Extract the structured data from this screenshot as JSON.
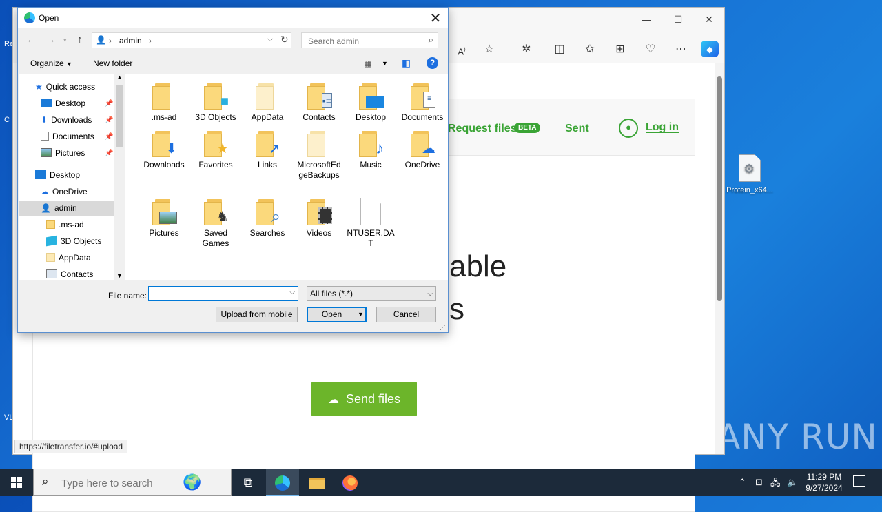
{
  "desktop": {
    "file_icon_label": "Protein_x64...",
    "left_fragments": [
      "Re",
      "C",
      "VL"
    ],
    "watermark": "ANY RUN"
  },
  "browser": {
    "window_controls": {
      "minimize": "—",
      "maximize": "☐",
      "close": "✕"
    },
    "toolbar_icons": [
      "read-aloud",
      "favorite-star",
      "extensions",
      "split-screen",
      "favorites",
      "collections",
      "browser-essentials",
      "more",
      "copilot"
    ],
    "page": {
      "nav": {
        "request_files": "Request files",
        "beta": "BETA",
        "sent": "Sent",
        "login": "Log in"
      },
      "hero_line1": "able",
      "hero_line2": "s",
      "send_button": "Send files"
    },
    "status_url": "https://filetransfer.io/#upload"
  },
  "dialog": {
    "title": "Open",
    "breadcrumb": [
      "admin"
    ],
    "search_placeholder": "Search admin",
    "organize_label": "Organize",
    "new_folder_label": "New folder",
    "nav_items": [
      {
        "label": "Quick access",
        "icon": "star-icon"
      },
      {
        "label": "Desktop",
        "icon": "desktop-icon",
        "pinned": true
      },
      {
        "label": "Downloads",
        "icon": "download-icon",
        "pinned": true
      },
      {
        "label": "Documents",
        "icon": "document-icon",
        "pinned": true
      },
      {
        "label": "Pictures",
        "icon": "picture-icon",
        "pinned": true
      },
      {
        "label": "Desktop",
        "icon": "desktop-icon"
      },
      {
        "label": "OneDrive",
        "icon": "cloud-icon"
      },
      {
        "label": "admin",
        "icon": "user-icon",
        "selected": true
      },
      {
        "label": ".ms-ad",
        "icon": "folder-icon"
      },
      {
        "label": "3D Objects",
        "icon": "cube-icon"
      },
      {
        "label": "AppData",
        "icon": "folder-icon"
      },
      {
        "label": "Contacts",
        "icon": "contacts-icon"
      }
    ],
    "files": [
      {
        "label": ".ms-ad",
        "icon": "folder"
      },
      {
        "label": "3D Objects",
        "icon": "cube"
      },
      {
        "label": "AppData",
        "icon": "folder-light"
      },
      {
        "label": "Contacts",
        "icon": "contacts"
      },
      {
        "label": "Desktop",
        "icon": "desktop"
      },
      {
        "label": "Documents",
        "icon": "documents"
      },
      {
        "label": "Downloads",
        "icon": "downloads"
      },
      {
        "label": "Favorites",
        "icon": "star"
      },
      {
        "label": "Links",
        "icon": "links"
      },
      {
        "label": "MicrosoftEdgeBackups",
        "icon": "folder-light"
      },
      {
        "label": "Music",
        "icon": "music"
      },
      {
        "label": "OneDrive",
        "icon": "cloud"
      },
      {
        "label": "Pictures",
        "icon": "pictures"
      },
      {
        "label": "Saved Games",
        "icon": "chess"
      },
      {
        "label": "Searches",
        "icon": "search"
      },
      {
        "label": "Videos",
        "icon": "film"
      },
      {
        "label": "NTUSER.DAT",
        "icon": "file"
      }
    ],
    "file_name_label": "File name:",
    "file_name_value": "",
    "file_type": "All files (*.*)",
    "upload_mobile_label": "Upload from mobile",
    "open_label": "Open",
    "cancel_label": "Cancel"
  },
  "taskbar": {
    "search_placeholder": "Type here to search",
    "time": "11:29 PM",
    "date": "9/27/2024"
  },
  "colors": {
    "accent_green": "#3aa435",
    "send_green": "#6cb52a",
    "selection_blue": "#0078d7"
  }
}
